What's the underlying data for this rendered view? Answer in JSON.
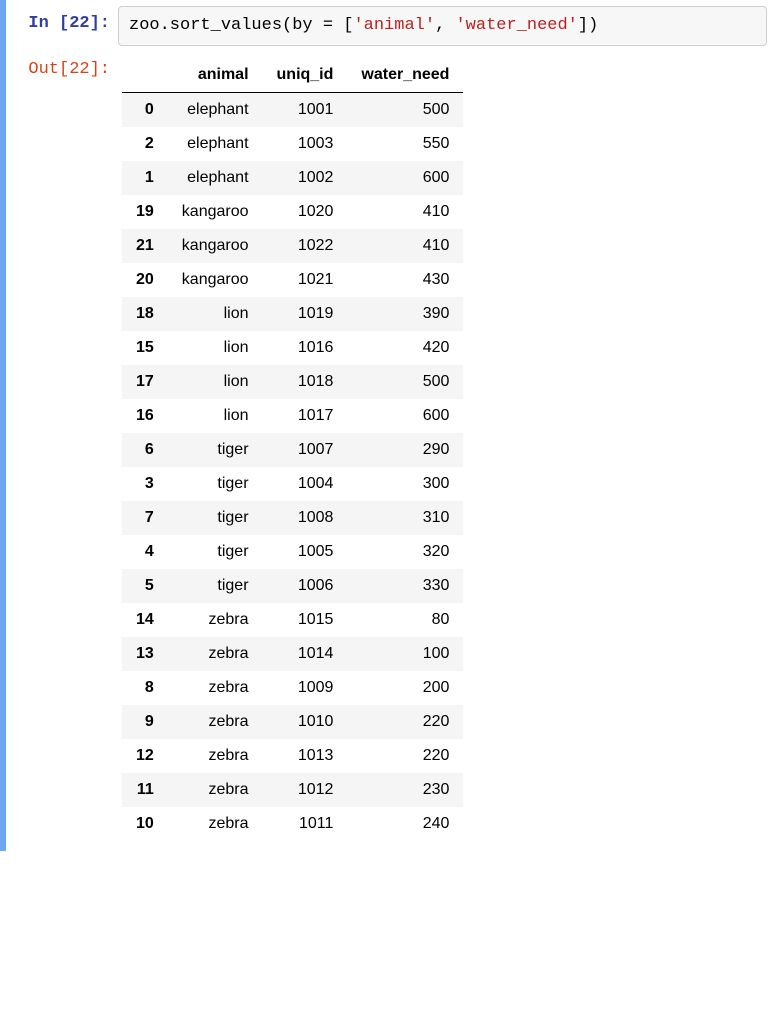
{
  "prompts": {
    "in_prefix": "In [",
    "out_prefix": "Out[",
    "suffix": "]:",
    "exec_count": "22"
  },
  "code": {
    "prefix": "zoo.sort_values(by = [",
    "str1": "'animal'",
    "sep": ", ",
    "str2": "'water_need'",
    "suffix": "])"
  },
  "table": {
    "columns": [
      "",
      "animal",
      "uniq_id",
      "water_need"
    ],
    "rows": [
      {
        "idx": "0",
        "animal": "elephant",
        "uniq_id": "1001",
        "water_need": "500"
      },
      {
        "idx": "2",
        "animal": "elephant",
        "uniq_id": "1003",
        "water_need": "550"
      },
      {
        "idx": "1",
        "animal": "elephant",
        "uniq_id": "1002",
        "water_need": "600"
      },
      {
        "idx": "19",
        "animal": "kangaroo",
        "uniq_id": "1020",
        "water_need": "410"
      },
      {
        "idx": "21",
        "animal": "kangaroo",
        "uniq_id": "1022",
        "water_need": "410"
      },
      {
        "idx": "20",
        "animal": "kangaroo",
        "uniq_id": "1021",
        "water_need": "430"
      },
      {
        "idx": "18",
        "animal": "lion",
        "uniq_id": "1019",
        "water_need": "390"
      },
      {
        "idx": "15",
        "animal": "lion",
        "uniq_id": "1016",
        "water_need": "420"
      },
      {
        "idx": "17",
        "animal": "lion",
        "uniq_id": "1018",
        "water_need": "500"
      },
      {
        "idx": "16",
        "animal": "lion",
        "uniq_id": "1017",
        "water_need": "600"
      },
      {
        "idx": "6",
        "animal": "tiger",
        "uniq_id": "1007",
        "water_need": "290"
      },
      {
        "idx": "3",
        "animal": "tiger",
        "uniq_id": "1004",
        "water_need": "300"
      },
      {
        "idx": "7",
        "animal": "tiger",
        "uniq_id": "1008",
        "water_need": "310"
      },
      {
        "idx": "4",
        "animal": "tiger",
        "uniq_id": "1005",
        "water_need": "320"
      },
      {
        "idx": "5",
        "animal": "tiger",
        "uniq_id": "1006",
        "water_need": "330"
      },
      {
        "idx": "14",
        "animal": "zebra",
        "uniq_id": "1015",
        "water_need": "80"
      },
      {
        "idx": "13",
        "animal": "zebra",
        "uniq_id": "1014",
        "water_need": "100"
      },
      {
        "idx": "8",
        "animal": "zebra",
        "uniq_id": "1009",
        "water_need": "200"
      },
      {
        "idx": "9",
        "animal": "zebra",
        "uniq_id": "1010",
        "water_need": "220"
      },
      {
        "idx": "12",
        "animal": "zebra",
        "uniq_id": "1013",
        "water_need": "220"
      },
      {
        "idx": "11",
        "animal": "zebra",
        "uniq_id": "1012",
        "water_need": "230"
      },
      {
        "idx": "10",
        "animal": "zebra",
        "uniq_id": "1011",
        "water_need": "240"
      }
    ]
  }
}
